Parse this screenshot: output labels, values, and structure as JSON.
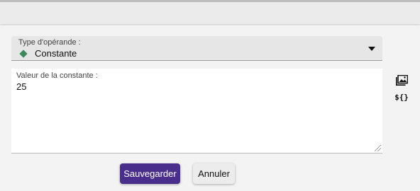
{
  "operand_type": {
    "label": "Type d'opérande :",
    "value": "Constante",
    "value_icon": "green-diamond-icon",
    "icon_color": "#3a8a5a"
  },
  "constant_value": {
    "label": "Valeur de la constante :",
    "value": "25"
  },
  "side_tools": {
    "image_icon": "image-icon",
    "variable_icon": "variable-icon",
    "variable_glyph": "${}"
  },
  "actions": {
    "save_label": "Sauvegarder",
    "cancel_label": "Annuler"
  },
  "colors": {
    "primary": "#4a2e8c"
  }
}
